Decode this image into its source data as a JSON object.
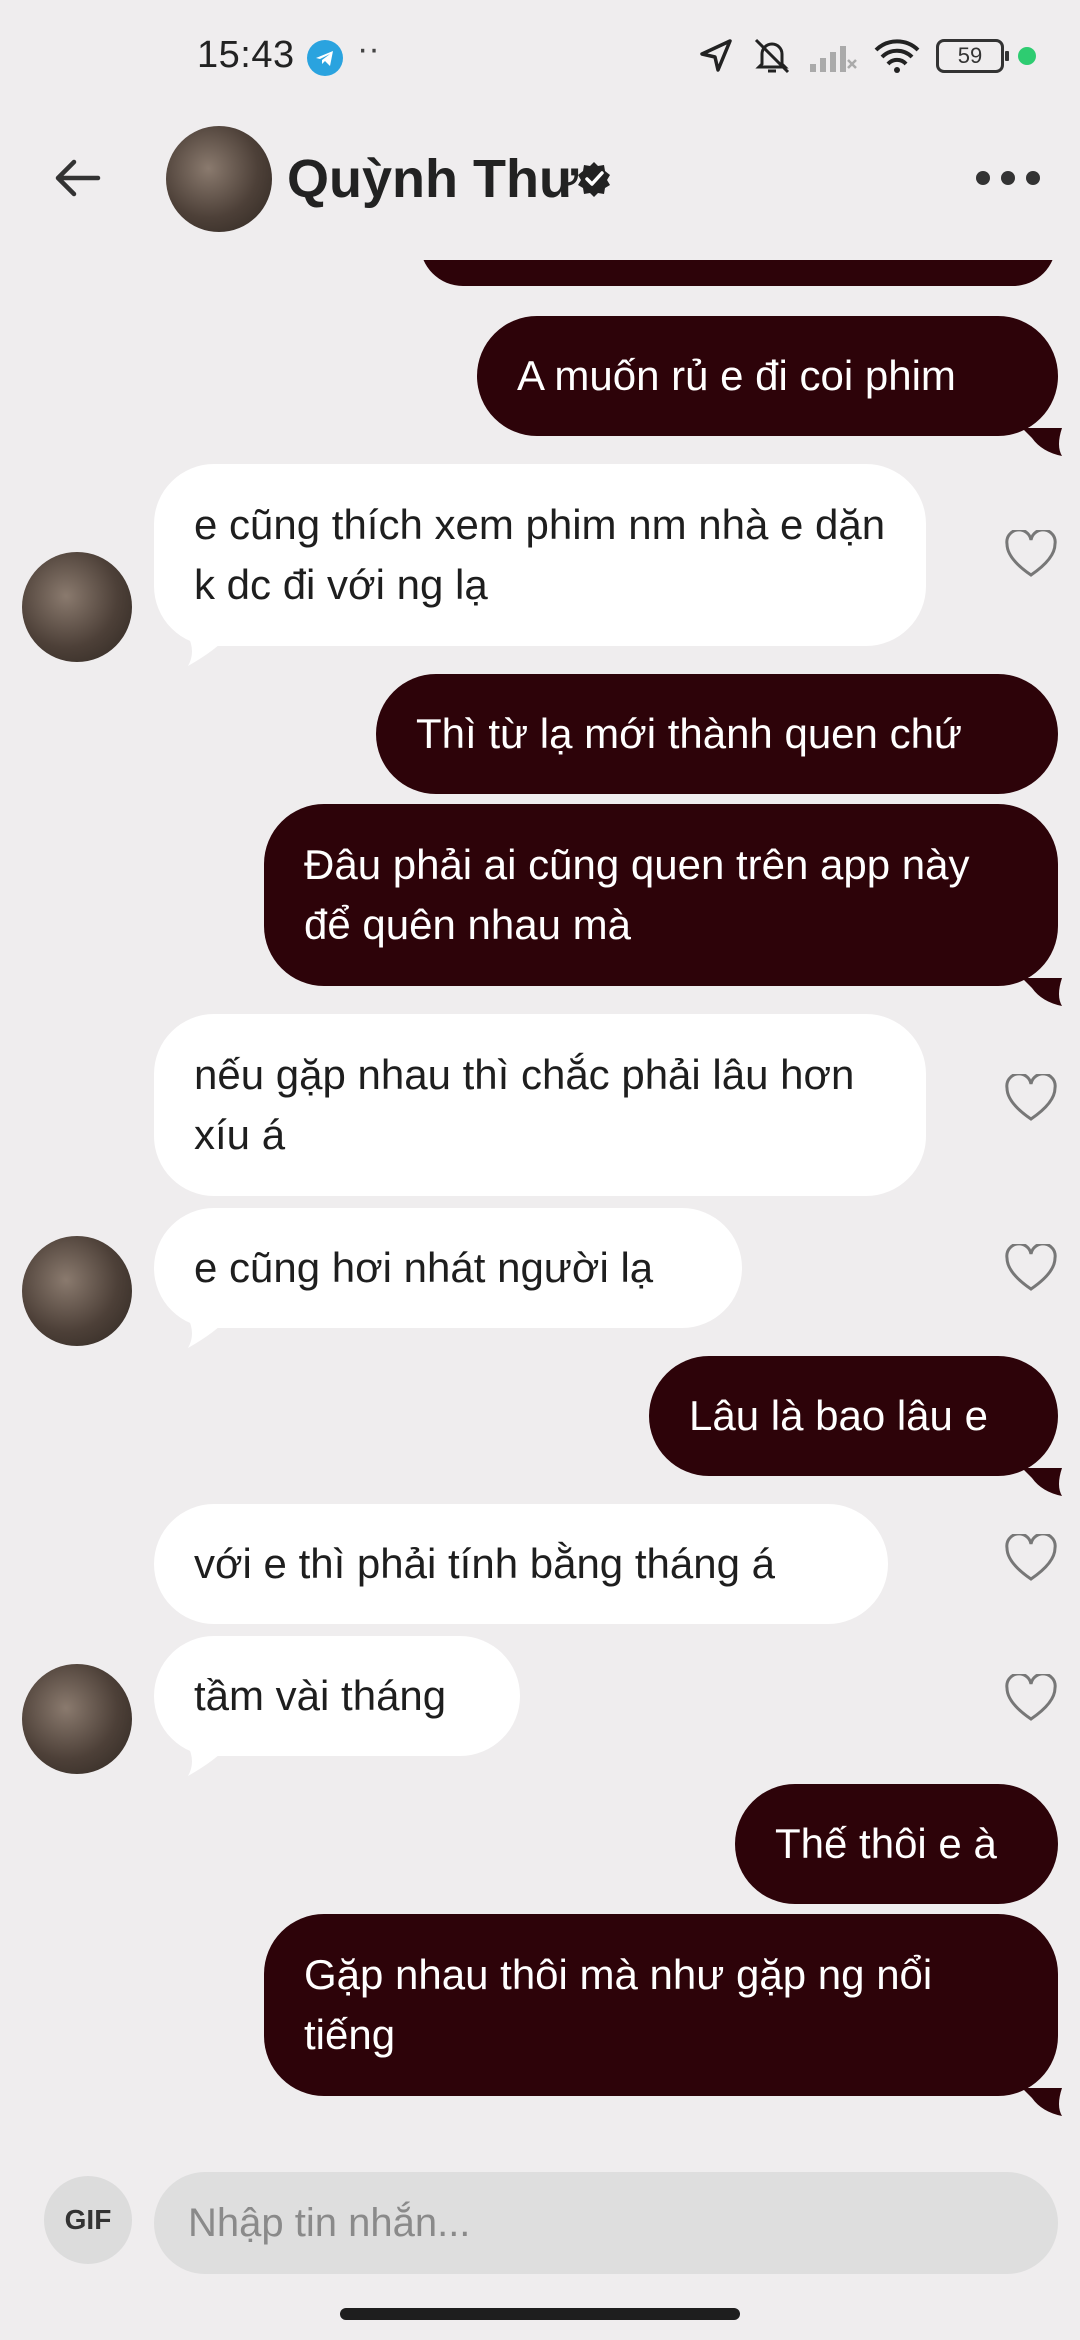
{
  "status_bar": {
    "time": "15:43",
    "battery": "59",
    "icons": [
      "telegram-icon",
      "location-icon",
      "mute-icon",
      "signal-icon",
      "wifi-icon",
      "battery-icon"
    ]
  },
  "header": {
    "name": "Quỳnh Thư",
    "verified": true
  },
  "messages": [
    {
      "dir": "out",
      "text": "A muốn rủ e đi coi phim"
    },
    {
      "dir": "in",
      "text": "e cũng thích xem phim nm nhà e dặn k dc đi với ng lạ"
    },
    {
      "dir": "out",
      "text": "Thì từ lạ mới thành quen chứ"
    },
    {
      "dir": "out",
      "text": "Đâu phải ai cũng quen trên app này để quên nhau mà"
    },
    {
      "dir": "in",
      "text": "nếu gặp nhau thì chắc phải lâu hơn xíu á"
    },
    {
      "dir": "in",
      "text": "e cũng hơi nhát người lạ"
    },
    {
      "dir": "out",
      "text": "Lâu là bao lâu e"
    },
    {
      "dir": "in",
      "text": "với e thì phải tính bằng tháng á"
    },
    {
      "dir": "in",
      "text": "tầm vài tháng"
    },
    {
      "dir": "out",
      "text": "Thế thôi e à"
    },
    {
      "dir": "out",
      "text": "Gặp nhau thôi mà như gặp ng nổi tiếng"
    }
  ],
  "composer": {
    "gif_label": "GIF",
    "placeholder": "Nhập tin nhắn..."
  },
  "colors": {
    "outgoing_bubble": "#2d0309",
    "incoming_bubble": "#ffffff",
    "background": "#efedee"
  }
}
